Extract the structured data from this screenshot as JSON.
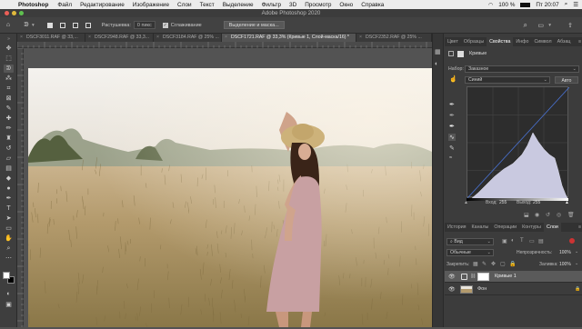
{
  "menubar": {
    "app": "Photoshop",
    "items": [
      "Файл",
      "Редактирование",
      "Изображение",
      "Слои",
      "Текст",
      "Выделение",
      "Фильтр",
      "3D",
      "Просмотр",
      "Окно",
      "Справка"
    ],
    "battery": "100 %",
    "clock": "Пт 20:07"
  },
  "window": {
    "title": "Adobe Photoshop 2020"
  },
  "options": {
    "feather_label": "Растушевка:",
    "feather_value": "0 пикс",
    "antialias_label": "Сглаживание",
    "select_mask_button": "Выделение и маска..."
  },
  "tabs": [
    {
      "label": "DSCF3011.RAF @ 33,..."
    },
    {
      "label": "DSCF2948.RAF @ 33,3..."
    },
    {
      "label": "DSCF3184.RAF @ 25% ..."
    },
    {
      "label": "DSCF1721.RAF @ 33,3% (Кривые 1, Слой-маска/16) *",
      "active": true
    },
    {
      "label": "DSCF2352.RAF @ 25% ..."
    }
  ],
  "panel_tabs": [
    "Цвет",
    "Образцы",
    "Свойства",
    "Инфо",
    "Символ",
    "Абзац"
  ],
  "panel_tabs_active": "Свойства",
  "properties": {
    "title": "Кривые",
    "preset_label": "Набор:",
    "preset_value": "Заказное",
    "channel_value": "Синий",
    "auto_button": "Авто",
    "input_label": "Вход:",
    "input_value": "255",
    "output_label": "Выход:",
    "output_value": "255"
  },
  "layers_tabs": [
    "История",
    "Каналы",
    "Операции",
    "Контуры",
    "Слои"
  ],
  "layers_tabs_active": "Слои",
  "layers": {
    "filter_kind": "Вид",
    "blend_mode": "Обычные",
    "opacity_label": "Непрозрачность:",
    "opacity_value": "100%",
    "lock_label": "Закрепить:",
    "fill_label": "Заливка:",
    "fill_value": "100%",
    "items": [
      {
        "name": "Кривые 1"
      },
      {
        "name": "Фон"
      }
    ]
  },
  "colors": {
    "accent": "#2d8ceb",
    "panel": "#3c3c3c",
    "canvas_bg": "#535353"
  }
}
